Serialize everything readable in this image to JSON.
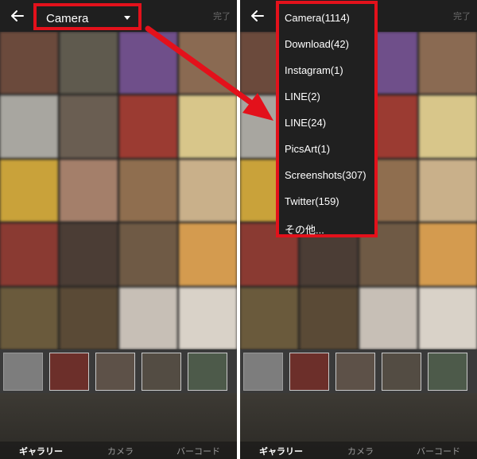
{
  "colors": {
    "highlight_red": "#e3111b",
    "topbar": "#1f1f1f",
    "done_text": "#6a6a6a"
  },
  "left_screen": {
    "header": {
      "back_icon": "arrow-left-icon",
      "album_name": "Camera",
      "dropdown_icon": "caret-down-icon",
      "done_label": "完了"
    },
    "tabs": [
      "ギャラリー",
      "カメラ",
      "バーコード"
    ]
  },
  "right_screen": {
    "header": {
      "back_icon": "arrow-left-icon",
      "done_label": "完了"
    },
    "folder_menu": [
      "Camera(1114)",
      "Download(42)",
      "Instagram(1)",
      "LINE(2)",
      "LINE(24)",
      "PicsArt(1)",
      "Screenshots(307)",
      "Twitter(159)",
      "その他..."
    ],
    "tabs": [
      "ギャラリー",
      "カメラ",
      "バーコード"
    ]
  },
  "grid_colors": [
    "#6b4a3c",
    "#5f5a4e",
    "#6f4f8a",
    "#8a6a52",
    "#a8a6a0",
    "#6a5e52",
    "#9b3b32",
    "#d8c68a",
    "#c9a23a",
    "#a47f6a",
    "#8f6e4f",
    "#c9b08a",
    "#8a3a32",
    "#4b3d35",
    "#6f5a45",
    "#d49b4f",
    "#6a5a3c",
    "#5a4a36",
    "#c7bfb6",
    "#d9d2c8"
  ]
}
